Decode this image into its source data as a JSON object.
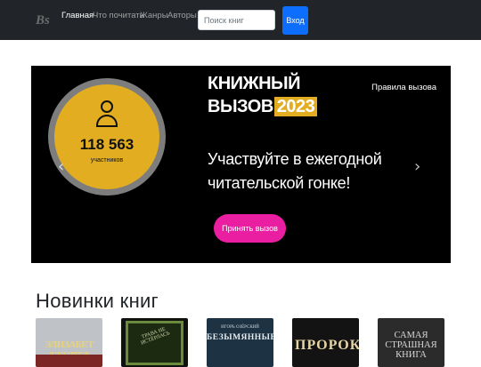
{
  "header": {
    "logo": "Bs",
    "nav": [
      {
        "label": "Главная",
        "active": true
      },
      {
        "label": "Что почитать",
        "active": false
      },
      {
        "label": "Жанры",
        "active": false
      },
      {
        "label": "Авторы",
        "active": false
      }
    ],
    "search_placeholder": "Поиск книг",
    "search_value": "",
    "login_label": "Вход"
  },
  "carousel": {
    "title_line1": "КНИЖНЫЙ",
    "title_line2": "ВЫЗОВ",
    "year": "2023",
    "rules_link": "Правила вызова",
    "participants_count": "118 563",
    "participants_label": "участников",
    "tagline": "Участвуйте в ежегодной читательской гонке!",
    "cta_label": "Принять вызов",
    "prev_icon": "‹",
    "next_icon": "›",
    "colors": {
      "accent": "#e2ad20",
      "cta": "#ea1ea0",
      "ring": "#7d7d7d"
    }
  },
  "new_books": {
    "title": "Новинки книг",
    "books": [
      {
        "author": "",
        "title": "ЭЛИЗАБЕТ ДЖОРДЖ"
      },
      {
        "author": "",
        "title": "ТРАВА НЕ ИСТЁРЛАСЬ"
      },
      {
        "author": "ИГОРЬ ОЗЁРСКИЙ",
        "title": "БЕЗЫМЯННЫЕ"
      },
      {
        "author": "",
        "title": "ПРОРОК"
      },
      {
        "author": "",
        "title": "САМАЯ СТРАШНАЯ КНИГА"
      }
    ]
  }
}
